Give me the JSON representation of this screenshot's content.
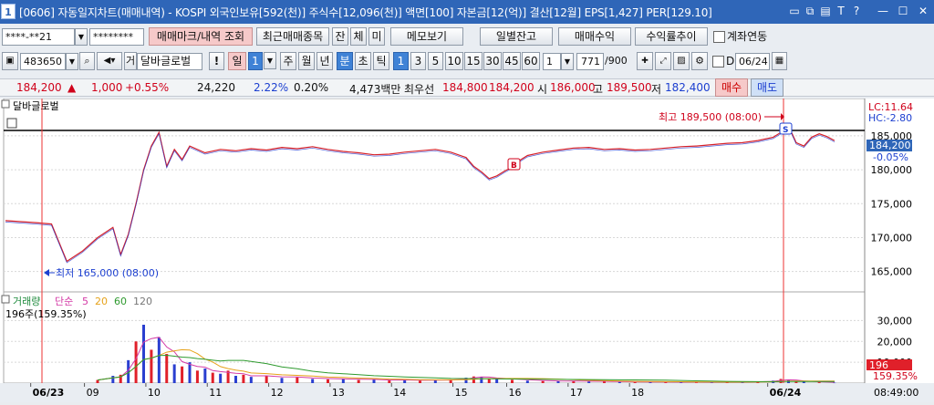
{
  "title": {
    "window_no": "1",
    "text": "[0606] 자동일지차트(매매내역) - KOSPI 외국인보유[592(천)] 주식수[12,096(천)] 액면[100] 자본금[12(억)] 결산[12월] EPS[1,427] PER[129.10]",
    "icons": [
      "restore-icon",
      "copy-icon",
      "save-icon",
      "text-icon",
      "help-icon",
      "minimize-icon",
      "maximize-icon",
      "close-icon"
    ]
  },
  "row1": {
    "account": "****-**21",
    "password": "********",
    "trade_mark_btn": "매매마크/내역 조회",
    "recent_items_btn": "최근매매종목",
    "jan_btn": "잔",
    "che_btn": "체",
    "mi_btn": "미",
    "memo_btn": "메모보기",
    "daily_balance_btn": "일별잔고",
    "trade_profit_btn": "매매수익",
    "return_trend_btn": "수익률추이",
    "account_link_label": "계좌연동"
  },
  "row2": {
    "code": "483650",
    "gear_label": "거",
    "stock_name": "달바글로벌",
    "period_buttons": [
      "일",
      "1",
      "주",
      "월",
      "년",
      "분",
      "초",
      "틱"
    ],
    "minute_options": [
      "1",
      "3",
      "5",
      "10",
      "15",
      "30",
      "45",
      "60"
    ],
    "unit_value": "1",
    "count_value": "771",
    "count_max": "/900",
    "d_label": "D",
    "date_value": "06/24"
  },
  "price_strip": {
    "price": "184,200",
    "arrow": "▲",
    "change": "1,000",
    "change_pct": "+0.55%",
    "volume": "24,220",
    "vol_pct": "2.22%",
    "turnover": "0.20%",
    "amount": "4,473백만",
    "best_label": "최우선",
    "ask": "184,800",
    "bid": "184,200",
    "open_label": "시",
    "open": "186,000",
    "high_label": "고",
    "high": "189,500",
    "low_label": "저",
    "low": "182,400",
    "buy_btn": "매수",
    "sell_btn": "매도"
  },
  "chart_data": {
    "type": "line",
    "series_name": "달바글로벌",
    "lc_label": "LC:11.64",
    "hc_label": "HC:-2.80",
    "high_annotation": "최고 189,500 (08:00)",
    "low_annotation": "최저 165,000 (08:00)",
    "current_price": "184,200",
    "current_pct": "-0.05%",
    "price_ticks": [
      "185,000",
      "180,000",
      "175,000",
      "170,000",
      "165,000"
    ],
    "price_tick_values": [
      185000,
      180000,
      175000,
      170000,
      165000
    ],
    "ylim": [
      162000,
      190500
    ],
    "marker_b": "B",
    "marker_s": "S",
    "x_labels": [
      "06/23",
      "09",
      "10",
      "11",
      "12",
      "13",
      "14",
      "15",
      "16",
      "17",
      "18",
      "06/24"
    ],
    "x_time_label": "08:49:00",
    "price_points": [
      [
        0,
        172500
      ],
      [
        4,
        172200
      ],
      [
        6,
        172000
      ],
      [
        8,
        166500
      ],
      [
        10,
        168000
      ],
      [
        12,
        170000
      ],
      [
        14,
        171500
      ],
      [
        15,
        167500
      ],
      [
        16,
        170500
      ],
      [
        17,
        175000
      ],
      [
        18,
        180000
      ],
      [
        19,
        183500
      ],
      [
        20,
        185500
      ],
      [
        21,
        180500
      ],
      [
        22,
        183000
      ],
      [
        23,
        181500
      ],
      [
        24,
        183500
      ],
      [
        26,
        182500
      ],
      [
        28,
        183000
      ],
      [
        30,
        182800
      ],
      [
        32,
        183100
      ],
      [
        34,
        182900
      ],
      [
        36,
        183300
      ],
      [
        38,
        183100
      ],
      [
        40,
        183400
      ],
      [
        42,
        183000
      ],
      [
        44,
        182700
      ],
      [
        46,
        182500
      ],
      [
        48,
        182200
      ],
      [
        50,
        182300
      ],
      [
        52,
        182600
      ],
      [
        54,
        182800
      ],
      [
        56,
        183000
      ],
      [
        58,
        182600
      ],
      [
        60,
        181800
      ],
      [
        61,
        180500
      ],
      [
        62,
        179700
      ],
      [
        63,
        178700
      ],
      [
        64,
        179100
      ],
      [
        65,
        179800
      ],
      [
        66,
        180400
      ],
      [
        67,
        181400
      ],
      [
        68,
        182100
      ],
      [
        70,
        182600
      ],
      [
        72,
        182900
      ],
      [
        74,
        183200
      ],
      [
        76,
        183300
      ],
      [
        78,
        183000
      ],
      [
        80,
        183100
      ],
      [
        82,
        182900
      ],
      [
        84,
        183000
      ],
      [
        86,
        183200
      ],
      [
        88,
        183400
      ],
      [
        90,
        183500
      ],
      [
        92,
        183700
      ],
      [
        94,
        183900
      ],
      [
        96,
        184000
      ],
      [
        98,
        184300
      ],
      [
        100,
        184800
      ],
      [
        101,
        185500
      ],
      [
        102,
        186500
      ],
      [
        103,
        184000
      ],
      [
        104,
        183500
      ],
      [
        105,
        184800
      ],
      [
        106,
        185300
      ],
      [
        107,
        184900
      ],
      [
        108,
        184300
      ]
    ],
    "volume_label": "거래량",
    "ma_label": "단순",
    "ma_periods": [
      "5",
      "20",
      "60",
      "120"
    ],
    "volume_info": "196주(159.35%)",
    "volume_ticks": [
      "30,000",
      "20,000",
      "10,000"
    ],
    "volume_tick_values": [
      30000,
      20000,
      10000
    ],
    "volume_ylim": [
      0,
      35000
    ],
    "volume_current": "196",
    "volume_current_pct": "159.35%",
    "volume_bars": [
      [
        12,
        1500
      ],
      [
        14,
        3500
      ],
      [
        15,
        4000
      ],
      [
        16,
        11000
      ],
      [
        17,
        20000
      ],
      [
        18,
        28000
      ],
      [
        19,
        16000
      ],
      [
        20,
        22000
      ],
      [
        21,
        14000
      ],
      [
        22,
        9000
      ],
      [
        23,
        8000
      ],
      [
        24,
        10000
      ],
      [
        25,
        6000
      ],
      [
        26,
        7000
      ],
      [
        27,
        5000
      ],
      [
        28,
        4500
      ],
      [
        29,
        6000
      ],
      [
        30,
        3500
      ],
      [
        31,
        4000
      ],
      [
        32,
        3000
      ],
      [
        34,
        3500
      ],
      [
        36,
        2500
      ],
      [
        38,
        2800
      ],
      [
        40,
        2000
      ],
      [
        42,
        1800
      ],
      [
        44,
        2200
      ],
      [
        46,
        1500
      ],
      [
        48,
        1700
      ],
      [
        50,
        1300
      ],
      [
        52,
        1600
      ],
      [
        54,
        1200
      ],
      [
        56,
        1400
      ],
      [
        58,
        1800
      ],
      [
        60,
        2600
      ],
      [
        61,
        3200
      ],
      [
        62,
        3000
      ],
      [
        63,
        2400
      ],
      [
        64,
        2000
      ],
      [
        66,
        1600
      ],
      [
        68,
        1200
      ],
      [
        70,
        1000
      ],
      [
        72,
        900
      ],
      [
        74,
        1100
      ],
      [
        76,
        800
      ],
      [
        78,
        700
      ],
      [
        80,
        600
      ],
      [
        82,
        500
      ],
      [
        84,
        600
      ],
      [
        86,
        500
      ],
      [
        88,
        400
      ],
      [
        90,
        500
      ],
      [
        92,
        400
      ],
      [
        94,
        500
      ],
      [
        96,
        600
      ],
      [
        98,
        700
      ],
      [
        100,
        1200
      ],
      [
        101,
        2000
      ],
      [
        102,
        1500
      ],
      [
        103,
        900
      ],
      [
        104,
        700
      ],
      [
        106,
        400
      ],
      [
        108,
        196
      ]
    ],
    "colors": {
      "up": "#e0202a",
      "down": "#2a3fd0",
      "ma5": "#d43aa6",
      "ma20": "#e6a21a",
      "ma60": "#2e9a2e",
      "ma120": "#777777",
      "volume_label": "#1d8a3c"
    }
  }
}
